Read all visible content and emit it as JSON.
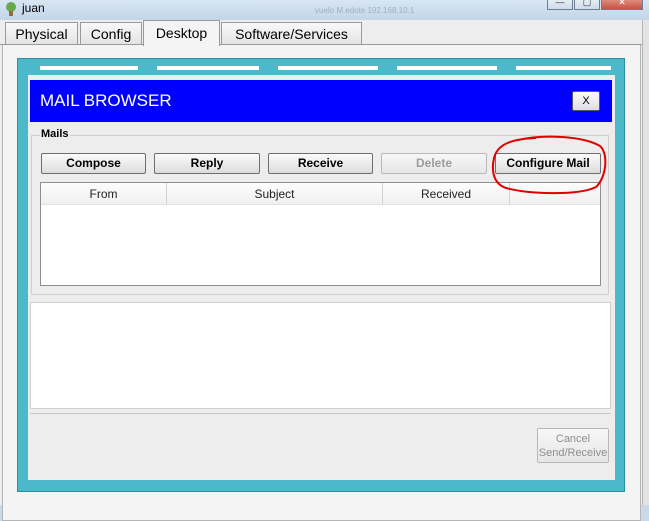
{
  "window": {
    "title": "juan",
    "faint_title": "vuelo M edote 192.168.10.1",
    "controls": [
      "—",
      "▢",
      "✕"
    ]
  },
  "tabs": [
    {
      "label": "Physical",
      "active": false
    },
    {
      "label": "Config",
      "active": false
    },
    {
      "label": "Desktop",
      "active": true
    },
    {
      "label": "Software/Services",
      "active": false
    }
  ],
  "mail_browser": {
    "title": "MAIL BROWSER",
    "close_label": "X",
    "accent_color": "#0000ff"
  },
  "mails": {
    "group_label": "Mails",
    "buttons": {
      "compose": "Compose",
      "reply": "Reply",
      "receive": "Receive",
      "delete": "Delete",
      "configure": "Configure Mail"
    },
    "columns": [
      "From",
      "Subject",
      "Received"
    ],
    "rows": []
  },
  "footer": {
    "cancel_line1": "Cancel",
    "cancel_line2": "Send/Receive"
  },
  "annotation": {
    "color": "#e00000",
    "shape": "hand-drawn-ellipse"
  }
}
